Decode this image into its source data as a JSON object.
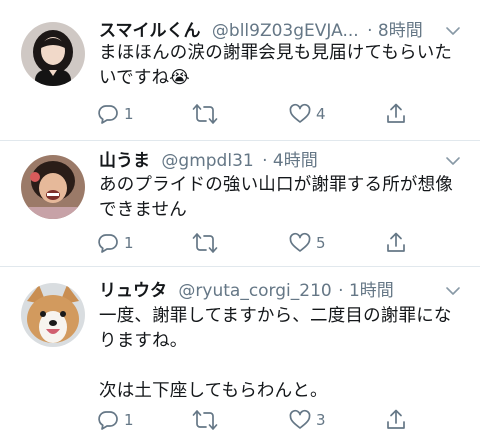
{
  "tweets": [
    {
      "display_name": "スマイルくん",
      "handle": "@bll9Z03gEVJA...",
      "time": "8時間",
      "dot": "·",
      "text": "まほほんの涙の謝罪会見も見届けてもらいたいですね😭",
      "replies": "1",
      "retweets": "",
      "likes": "4"
    },
    {
      "display_name": "山うま",
      "handle": "@gmpdl31",
      "time": "4時間",
      "dot": "·",
      "text": "あのプライドの強い山口が謝罪する所が想像できません",
      "replies": "1",
      "retweets": "",
      "likes": "5"
    },
    {
      "display_name": "リュウタ",
      "handle": "@ryuta_corgi_210",
      "time": "1時間",
      "dot": "·",
      "text": "一度、謝罪してますから、二度目の謝罪になりますね。\n\n次は土下座してもらわんと。",
      "replies": "1",
      "retweets": "",
      "likes": "3"
    }
  ],
  "icons": {
    "reply": "reply-icon",
    "retweet": "retweet-icon",
    "like": "heart-icon",
    "share": "share-icon",
    "menu": "chevron-down-icon"
  },
  "colors": {
    "name": "#14171a",
    "meta": "#657786",
    "divider": "#e1e8ed"
  }
}
